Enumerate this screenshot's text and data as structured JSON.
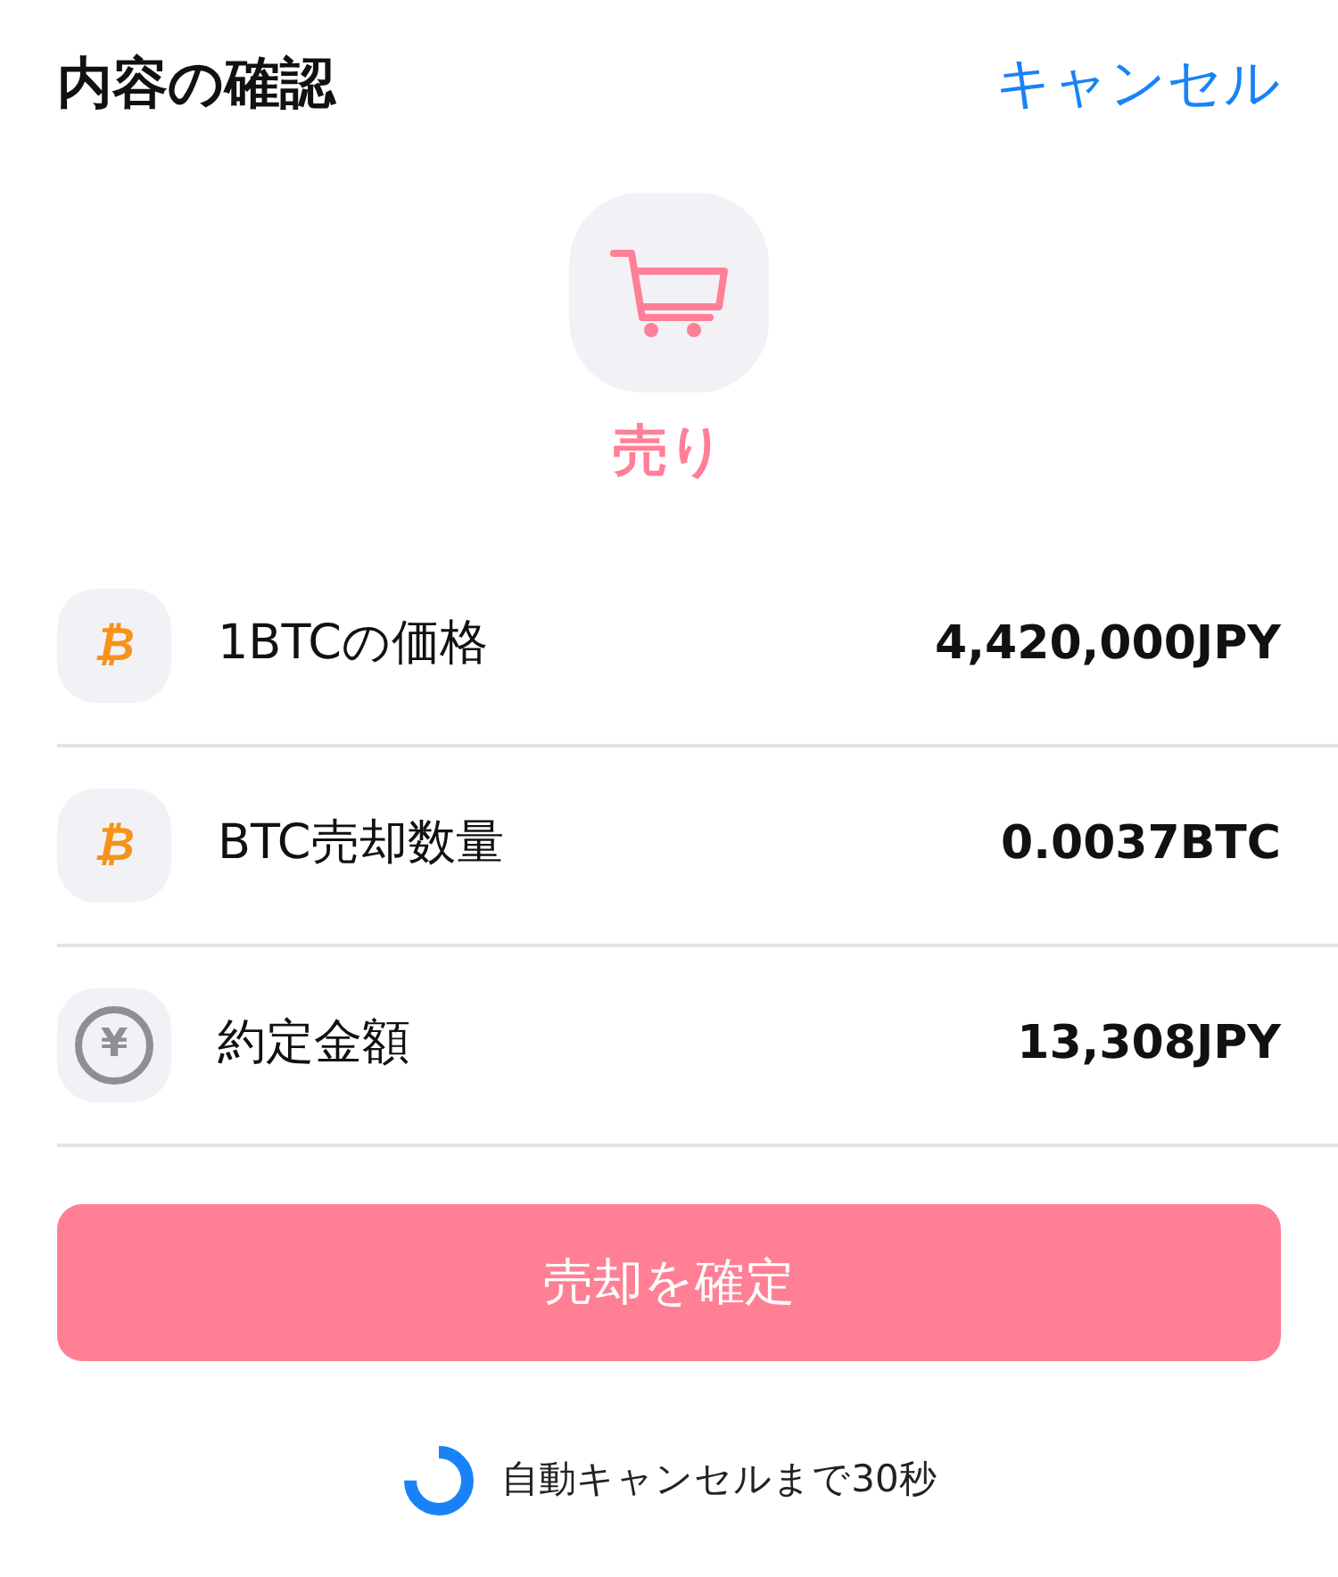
{
  "header": {
    "title": "内容の確認",
    "cancel": "キャンセル"
  },
  "order": {
    "label": "売り"
  },
  "rows": [
    {
      "kind": "bitcoin",
      "glyph": "₿",
      "label": "1BTCの価格",
      "value": "4,420,000JPY"
    },
    {
      "kind": "bitcoin",
      "glyph": "₿",
      "label": "BTC売却数量",
      "value": "0.0037BTC"
    },
    {
      "kind": "yen",
      "glyph": "¥",
      "label": "約定金額",
      "value": "13,308JPY"
    }
  ],
  "confirm_button": "売却を確定",
  "countdown": {
    "text": "自動キャンセルまで30秒"
  }
}
